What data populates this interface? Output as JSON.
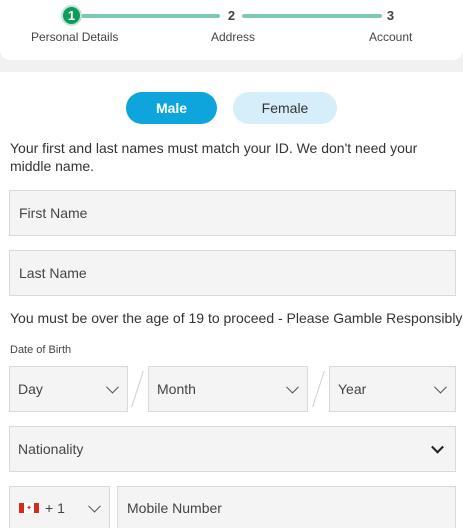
{
  "stepper": {
    "steps": [
      {
        "number": "1",
        "label": "Personal Details",
        "active": true
      },
      {
        "number": "2",
        "label": "Address",
        "active": false
      },
      {
        "number": "3",
        "label": "Account",
        "active": false
      }
    ],
    "colors": {
      "active": "#0e9b5c",
      "line": "#7ec8b4"
    }
  },
  "gender": {
    "male_label": "Male",
    "female_label": "Female",
    "selected": "Male",
    "colors": {
      "selected_bg": "#0ea5dd",
      "unselected_bg": "#d5eef9"
    }
  },
  "names_note": "Your first and last names must match your ID. We don't need your middle name.",
  "first_name": {
    "placeholder": "First Name",
    "value": ""
  },
  "last_name": {
    "placeholder": "Last Name",
    "value": ""
  },
  "age_note": "You must be over the age of 19 to proceed - Please Gamble Responsibly",
  "dob": {
    "label": "Date of Birth",
    "day": "Day",
    "month": "Month",
    "year": "Year"
  },
  "nationality": {
    "selected": "Nationality"
  },
  "phone": {
    "flag_icon": "canada-flag-icon",
    "country_code": "+ 1",
    "placeholder": "Mobile Number"
  }
}
